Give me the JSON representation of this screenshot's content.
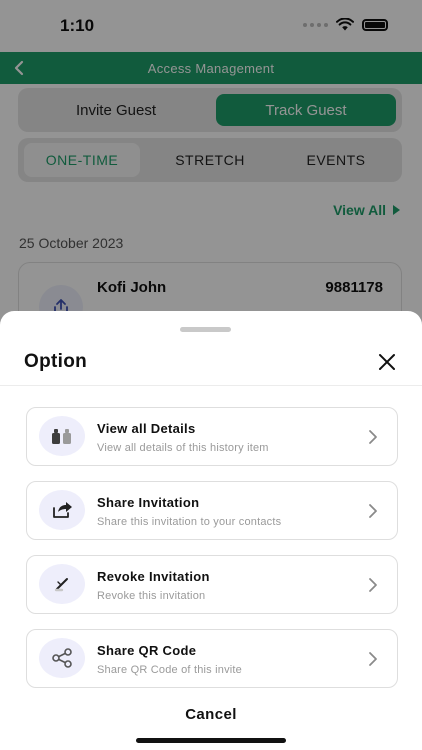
{
  "status_bar": {
    "time": "1:10"
  },
  "header": {
    "title": "Access Management"
  },
  "top_tabs": [
    {
      "label": "Invite Guest"
    },
    {
      "label": "Track Guest"
    }
  ],
  "sub_tabs": [
    {
      "label": "ONE-TIME"
    },
    {
      "label": "STRETCH"
    },
    {
      "label": "EVENTS"
    }
  ],
  "view_all_label": "View All",
  "date_label": "25 October 2023",
  "history_card": {
    "name": "Kofi John",
    "code": "9881178"
  },
  "sheet": {
    "title": "Option",
    "options": [
      {
        "title": "View all Details",
        "subtitle": "View all details of this history item",
        "icon": "details-icon"
      },
      {
        "title": "Share Invitation",
        "subtitle": "Share this invitation to your contacts",
        "icon": "share-forward-icon"
      },
      {
        "title": "Revoke Invitation",
        "subtitle": "Revoke this invitation",
        "icon": "revoke-icon"
      },
      {
        "title": "Share QR Code",
        "subtitle": "Share QR Code of this invite",
        "icon": "share-nodes-icon"
      }
    ],
    "cancel_label": "Cancel"
  },
  "colors": {
    "accent": "#1e9e6a",
    "icon_bg": "#eeeefb",
    "icon_fg": "#3f51b5"
  }
}
